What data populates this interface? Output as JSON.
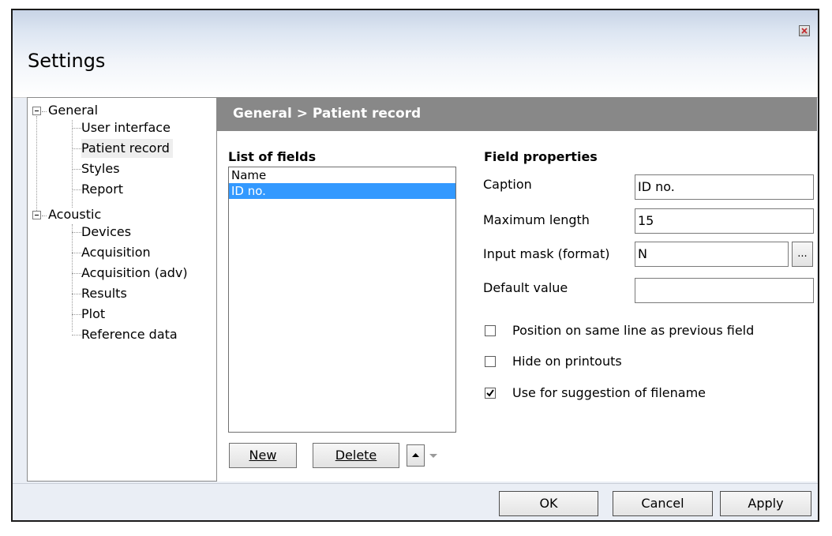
{
  "window": {
    "title": "Settings",
    "close_icon": "close-icon"
  },
  "tree": {
    "groups": [
      {
        "label": "General",
        "items": [
          "User interface",
          "Patient record",
          "Styles",
          "Report"
        ]
      },
      {
        "label": "Acoustic",
        "items": [
          "Devices",
          "Acquisition",
          "Acquisition (adv)",
          "Results",
          "Plot",
          "Reference data"
        ]
      }
    ],
    "selected": "Patient record"
  },
  "panel": {
    "header": "General > Patient record",
    "list_title": "List of fields",
    "fields": [
      "Name",
      "ID no."
    ],
    "selected_field": "ID no.",
    "buttons": {
      "new": "New",
      "delete": "Delete",
      "move_up_icon": "arrow-up-icon",
      "move_down_icon": "arrow-down-icon"
    },
    "properties": {
      "title": "Field properties",
      "caption_label": "Caption",
      "caption_value": "ID no.",
      "max_length_label": "Maximum length",
      "max_length_value": "15",
      "input_mask_label": "Input mask (format)",
      "input_mask_value": "N",
      "browse_label": "...",
      "default_value_label": "Default value",
      "default_value": ""
    },
    "options": [
      {
        "label": "Position on same line as previous field",
        "checked": false
      },
      {
        "label": "Hide on printouts",
        "checked": false
      },
      {
        "label": "Use for suggestion of filename",
        "checked": true
      }
    ]
  },
  "footer": {
    "ok": "OK",
    "cancel": "Cancel",
    "apply": "Apply"
  },
  "colors": {
    "header_bg": "#888888",
    "selection": "#3399ff",
    "window_bg": "#eaeef5"
  }
}
